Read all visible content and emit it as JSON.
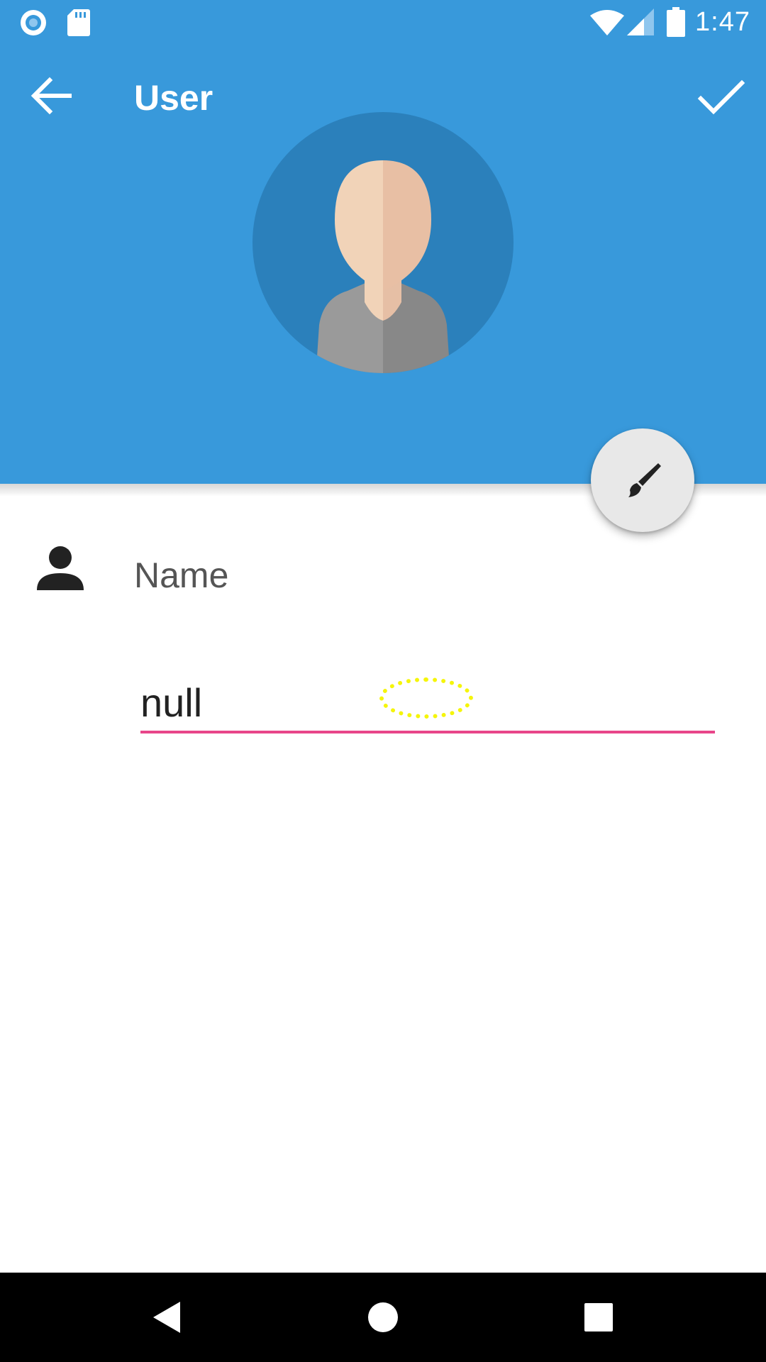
{
  "status_bar": {
    "time": "1:47",
    "left_icons": [
      "record-icon",
      "sd-card-icon"
    ],
    "right_icons": [
      "wifi-icon",
      "signal-icon",
      "battery-icon"
    ]
  },
  "toolbar": {
    "title": "User",
    "back_icon": "arrow-back-icon",
    "confirm_icon": "check-icon"
  },
  "profile": {
    "avatar_icon": "user-avatar-icon",
    "edit_fab_icon": "brush-icon"
  },
  "form": {
    "name_label": "Name",
    "name_value": "null",
    "field_icon": "person-icon"
  },
  "nav_bar": {
    "buttons": [
      "back-triangle-icon",
      "home-circle-icon",
      "recents-square-icon"
    ]
  },
  "colors": {
    "primary": "#3899DB",
    "avatar_bg": "#2B80BB",
    "accent": "#E8468A",
    "fab_bg": "#E8E8E8",
    "touch_marker": "#F5F50A"
  }
}
